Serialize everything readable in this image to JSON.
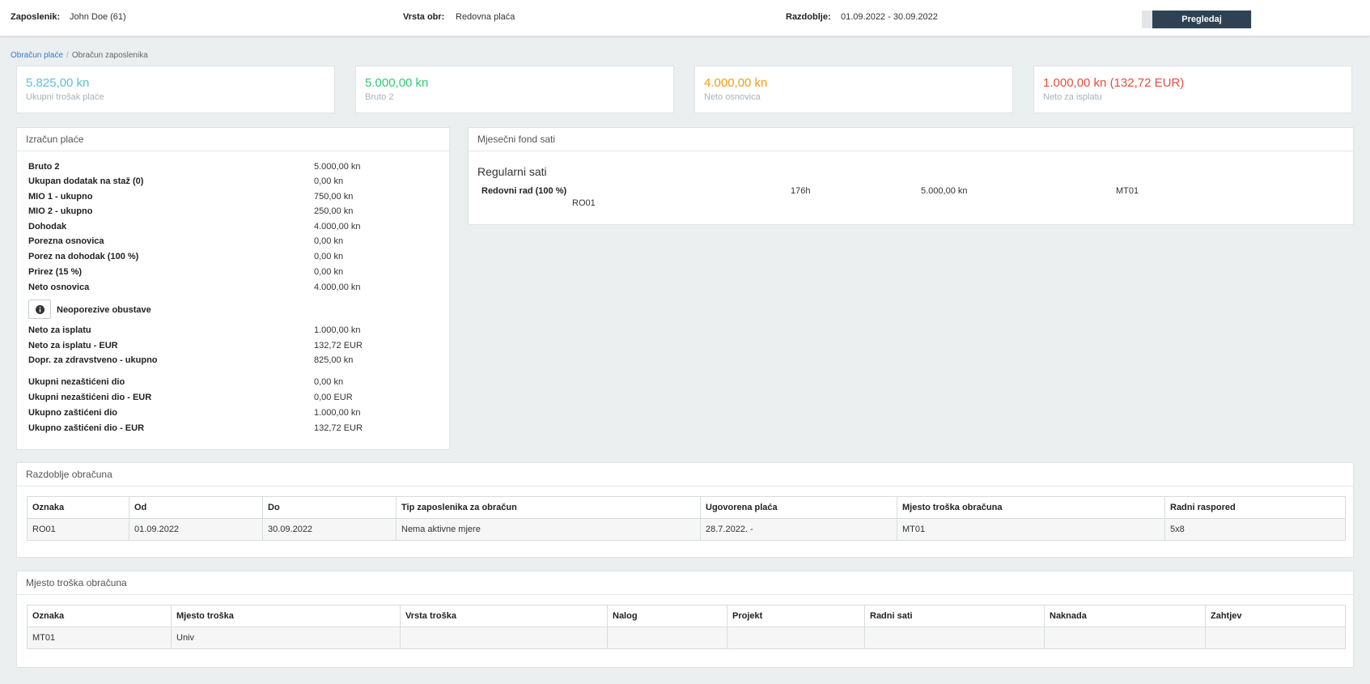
{
  "colors": {
    "total_cost": "#5bc0de",
    "gross2": "#2ecc71",
    "net_base": "#f39c12",
    "net_payout": "#e74c3c",
    "primary_button": "#2f4254",
    "link": "#3b78c5"
  },
  "header": {
    "employee_label": "Zaposlenik:",
    "employee_value": "John Doe (61)",
    "type_label": "Vrsta obr:",
    "type_value": "Redovna plaća",
    "period_label": "Razdoblje:",
    "period_value": "01.09.2022 - 30.09.2022",
    "view_button": "Pregledaj"
  },
  "breadcrumb": {
    "parent": "Obračun plaće",
    "current": "Obračun zaposlenika"
  },
  "stats": [
    {
      "value": "5.825,00 kn",
      "label": "Ukupni trošak plaće"
    },
    {
      "value": "5.000,00 kn",
      "label": "Bruto 2"
    },
    {
      "value": "4.000,00 kn",
      "label": "Neto osnovica"
    },
    {
      "value": "1.000,00 kn (132,72 EUR)",
      "label": "Neto za isplatu"
    }
  ],
  "calculation": {
    "title": "Izračun plaće",
    "rows": [
      {
        "label": "Bruto 2",
        "value": "5.000,00 kn"
      },
      {
        "label": "Ukupan dodatak na staž (0)",
        "value": "0,00 kn"
      },
      {
        "label": "MIO 1 - ukupno",
        "value": "750,00 kn"
      },
      {
        "label": "MIO 2 - ukupno",
        "value": "250,00 kn"
      },
      {
        "label": "Dohodak",
        "value": "4.000,00 kn"
      },
      {
        "label": "Porezna osnovica",
        "value": "0,00 kn"
      },
      {
        "label": "Porez na dohodak (100 %)",
        "value": "0,00 kn"
      },
      {
        "label": "Prirez (15 %)",
        "value": "0,00 kn"
      },
      {
        "label": "Neto osnovica",
        "value": "4.000,00 kn"
      }
    ],
    "deductions_label": "Neoporezive obustave",
    "rows2": [
      {
        "label": "Neto za isplatu",
        "value": "1.000,00 kn"
      },
      {
        "label": "Neto za isplatu - EUR",
        "value": "132,72 EUR"
      },
      {
        "label": "Dopr. za zdravstveno - ukupno",
        "value": "825,00 kn"
      }
    ],
    "rows3": [
      {
        "label": "Ukupni nezaštićeni dio",
        "value": "0,00 kn"
      },
      {
        "label": "Ukupni nezaštićeni dio - EUR",
        "value": "0,00 EUR"
      },
      {
        "label": "Ukupno zaštićeni dio",
        "value": "1.000,00 kn"
      },
      {
        "label": "Ukupno zaštićeni dio - EUR",
        "value": "132,72 EUR"
      }
    ]
  },
  "fund": {
    "title": "Mjesečni fond sati",
    "section": "Regularni sati",
    "row": {
      "name": "Redovni rad (100 %)",
      "hours": "176h",
      "amount": "5.000,00 kn",
      "cost_center": "MT01",
      "period": "RO01"
    }
  },
  "period_table": {
    "title": "Razdoblje obračuna",
    "headers": [
      "Oznaka",
      "Od",
      "Do",
      "Tip zaposlenika za obračun",
      "Ugovorena plaća",
      "Mjesto troška obračuna",
      "Radni raspored"
    ],
    "rows": [
      [
        "RO01",
        "01.09.2022",
        "30.09.2022",
        "Nema aktivne mjere",
        "28.7.2022. -",
        "MT01",
        "5x8"
      ]
    ]
  },
  "cost_table": {
    "title": "Mjesto troška obračuna",
    "headers": [
      "Oznaka",
      "Mjesto troška",
      "Vrsta troška",
      "Nalog",
      "Projekt",
      "Radni sati",
      "Naknada",
      "Zahtjev"
    ],
    "rows": [
      [
        "MT01",
        "Univ",
        "",
        "",
        "",
        "",
        "",
        ""
      ]
    ]
  }
}
